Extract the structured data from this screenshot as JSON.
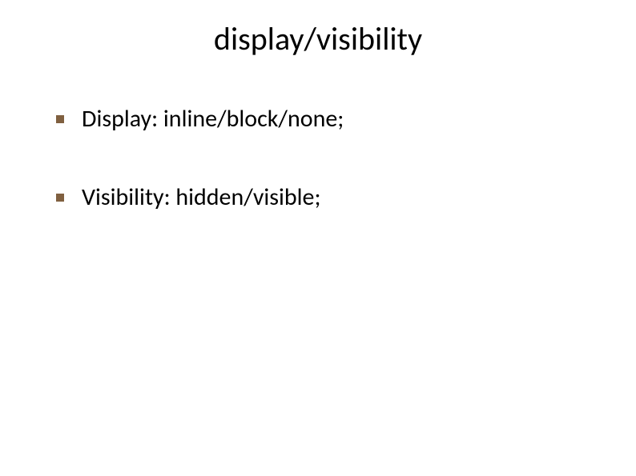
{
  "slide": {
    "title": "display/visibility",
    "bullets": [
      {
        "text": "Display: inline/block/none;"
      },
      {
        "text": "Visibility: hidden/visible;"
      }
    ]
  },
  "colors": {
    "bullet": "#806040"
  }
}
